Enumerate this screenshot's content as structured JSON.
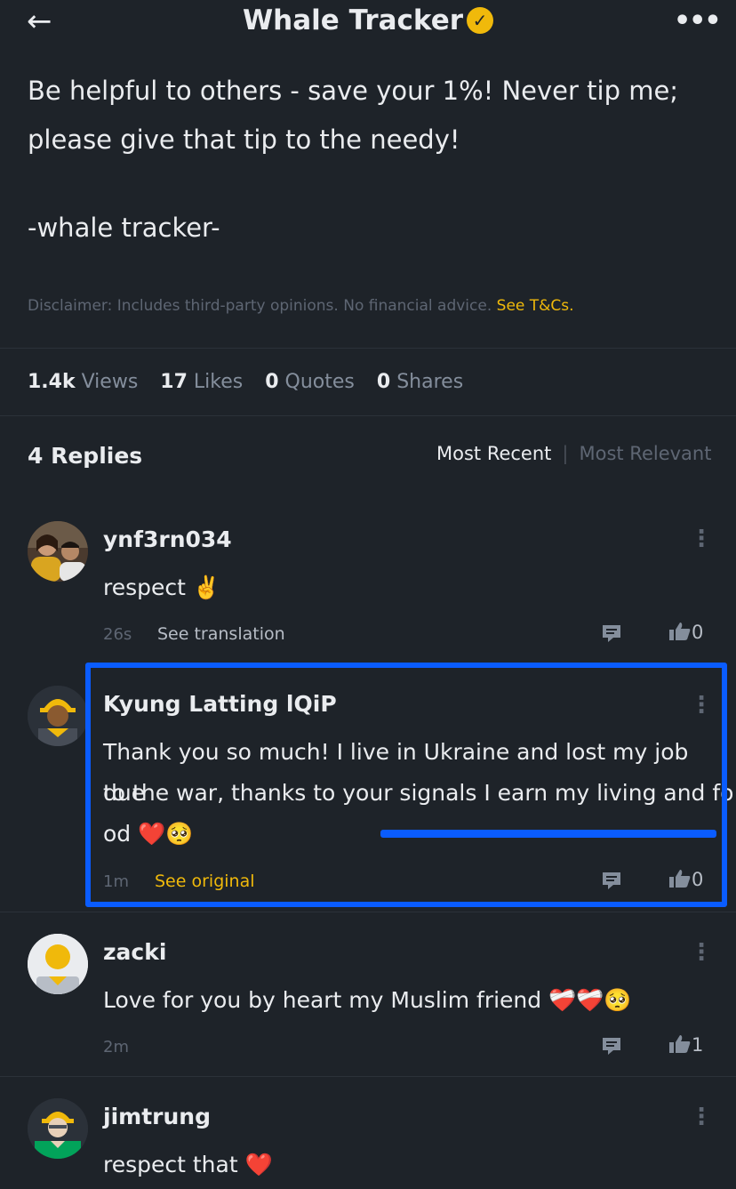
{
  "header": {
    "title": "Whale Tracker",
    "back_icon": "arrow-left-icon",
    "verified_icon": "verified-check-icon",
    "more_icon": "more-horizontal-icon"
  },
  "post": {
    "line1": "Be helpful to others - save your 1%! Never tip me;",
    "line2": "please give that tip to the needy!",
    "signature": "-whale tracker-",
    "disclaimer": "Disclaimer: Includes third-party opinions. No financial advice.",
    "disclaimer_link": "See T&Cs."
  },
  "stats": {
    "views": "1.4k",
    "views_label": "Views",
    "likes": "17",
    "likes_label": "Likes",
    "quotes": "0",
    "quotes_label": "Quotes",
    "shares": "0",
    "shares_label": "Shares"
  },
  "replies": {
    "title": "4 Replies",
    "sort_active": "Most Recent",
    "sort_inactive": "Most Relevant"
  },
  "comments": [
    {
      "username": "ynf3rn034",
      "text": "respect ✌️",
      "time": "26s",
      "action": "See translation",
      "likes": "0"
    },
    {
      "username": "Kyung Latting lQiP",
      "line1": "Thank you so much! I live in Ukraine and lost my job due",
      "line2": "to the war, thanks to your signals I earn my living and fo",
      "line3": "od ❤️🥺",
      "time": "1m",
      "action": "See original",
      "likes": "0"
    },
    {
      "username": "zacki",
      "text": "Love for you by heart my Muslim friend ❤️‍🩹❤️‍🩹🥺",
      "time": "2m",
      "likes": "1"
    },
    {
      "username": "jimtrung",
      "text": "respect that ❤️"
    }
  ],
  "colors": {
    "background": "#1e2329",
    "accent": "#f0b90b",
    "highlight": "#0a5cff"
  }
}
